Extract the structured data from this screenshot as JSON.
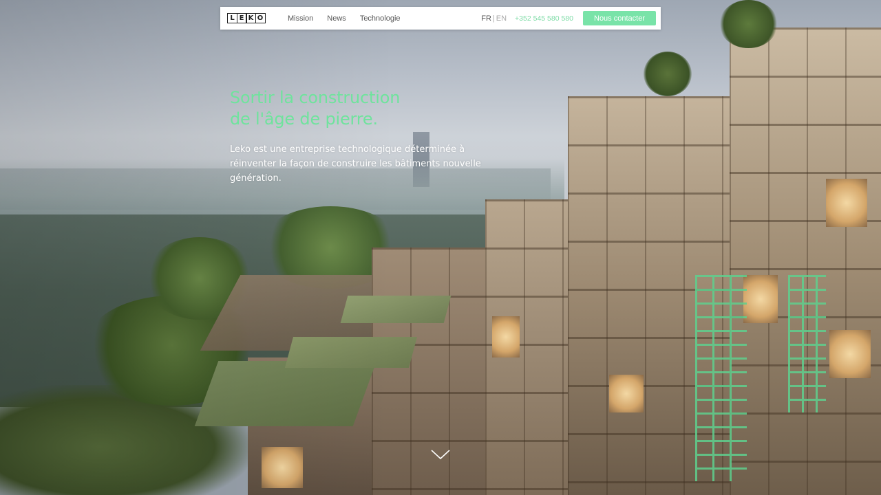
{
  "brand": {
    "logo_letters": [
      "L",
      "E",
      "K",
      "O"
    ]
  },
  "nav": {
    "links": [
      {
        "label": "Mission"
      },
      {
        "label": "News"
      },
      {
        "label": "Technologie"
      }
    ],
    "lang_active": "FR",
    "lang_separator": "|",
    "lang_inactive": "EN",
    "phone": "+352 545 580 580",
    "cta_label": "Nous contacter"
  },
  "hero": {
    "title_line1": "Sortir la construction",
    "title_line2": "de l'âge de pierre.",
    "description": "Leko est une entreprise technologique déterminée à réinventer la façon de construire les bâtiments nouvelle génération."
  },
  "icons": {
    "scroll": "chevron-down-icon"
  },
  "colors": {
    "accent": "#79e3a8",
    "title": "#6fe39d",
    "nav_bg": "#ffffff",
    "nav_text": "#555555"
  }
}
